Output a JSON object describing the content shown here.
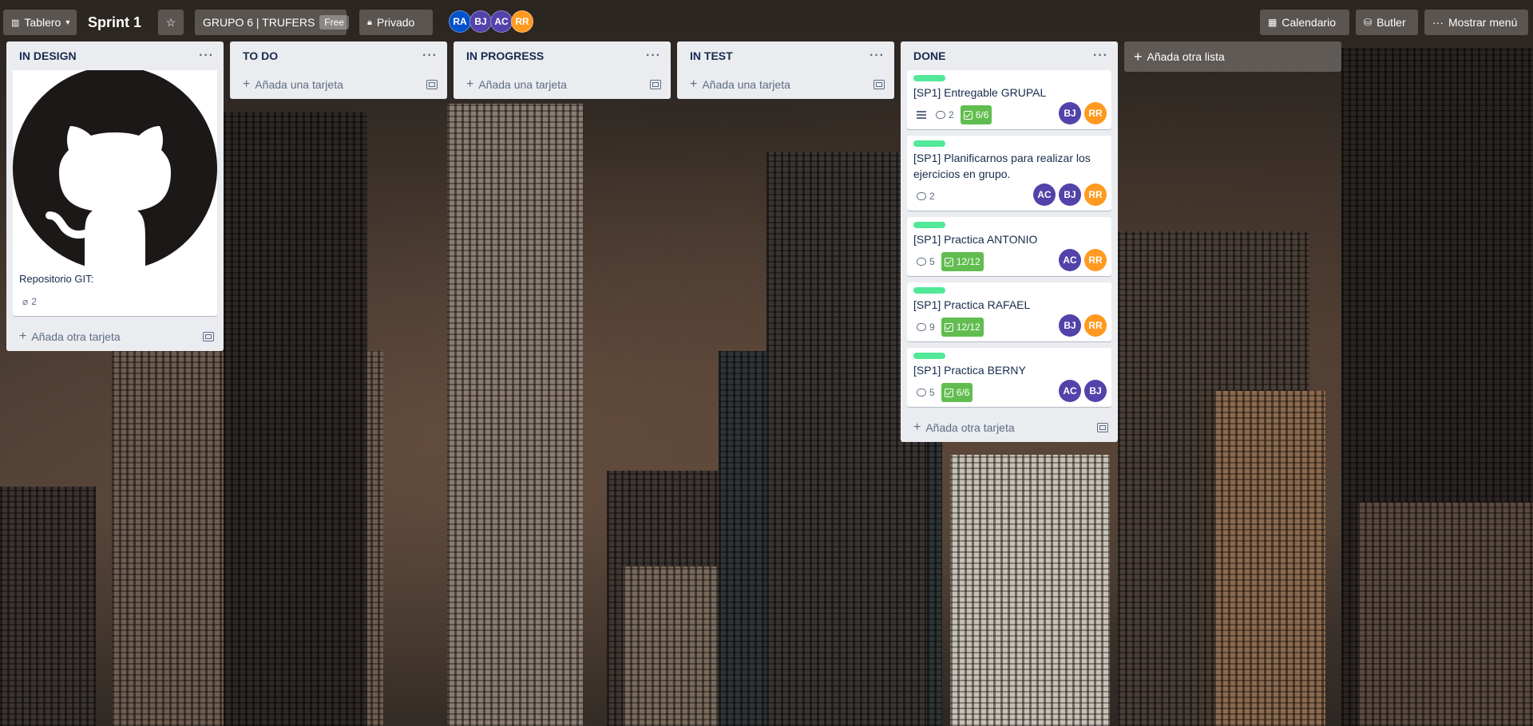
{
  "header": {
    "view_switcher": "Tablero",
    "board_title": "Sprint 1",
    "workspace": "GRUPO 6 | TRUFERS",
    "workspace_badge": "Free",
    "visibility": "Privado",
    "members": [
      {
        "initials": "RA",
        "color": "#0052cc"
      },
      {
        "initials": "BJ",
        "color": "#5243aa"
      },
      {
        "initials": "AC",
        "color": "#5243aa"
      },
      {
        "initials": "RR",
        "color": "#ff991f"
      }
    ],
    "calendar": "Calendario",
    "butler": "Butler",
    "show_menu": "Mostrar menú"
  },
  "lists": {
    "in_design": {
      "title": "IN DESIGN",
      "card_title": "Repositorio GIT:",
      "attachments": "2",
      "add_card": "Añada otra tarjeta"
    },
    "todo": {
      "title": "TO DO",
      "add_card": "Añada una tarjeta"
    },
    "in_progress": {
      "title": "IN PROGRESS",
      "add_card": "Añada una tarjeta"
    },
    "in_test": {
      "title": "IN TEST",
      "add_card": "Añada una tarjeta"
    },
    "done": {
      "title": "DONE",
      "add_card": "Añada otra tarjeta",
      "cards": [
        {
          "title": "[SP1] Entregable GRUPAL",
          "comments": "2",
          "checklist": "6/6",
          "members": [
            "BJ",
            "RR"
          ]
        },
        {
          "title": "[SP1] Planificarnos para realizar los ejercicios en grupo.",
          "comments": "2",
          "members": [
            "AC",
            "BJ",
            "RR"
          ]
        },
        {
          "title": "[SP1] Practica ANTONIO",
          "comments": "5",
          "checklist": "12/12",
          "members": [
            "AC",
            "RR"
          ]
        },
        {
          "title": "[SP1] Practica RAFAEL",
          "comments": "9",
          "checklist": "12/12",
          "members": [
            "BJ",
            "RR"
          ]
        },
        {
          "title": "[SP1] Practica BERNY",
          "comments": "5",
          "checklist": "6/6",
          "members": [
            "AC",
            "BJ"
          ]
        }
      ]
    }
  },
  "add_list": "Añada otra lista",
  "colors": {
    "label_green": "#51e898",
    "checklist_complete": "#61bd4f",
    "avatar_purple": "#5243aa",
    "avatar_orange": "#ff991f",
    "avatar_blue": "#0052cc"
  }
}
